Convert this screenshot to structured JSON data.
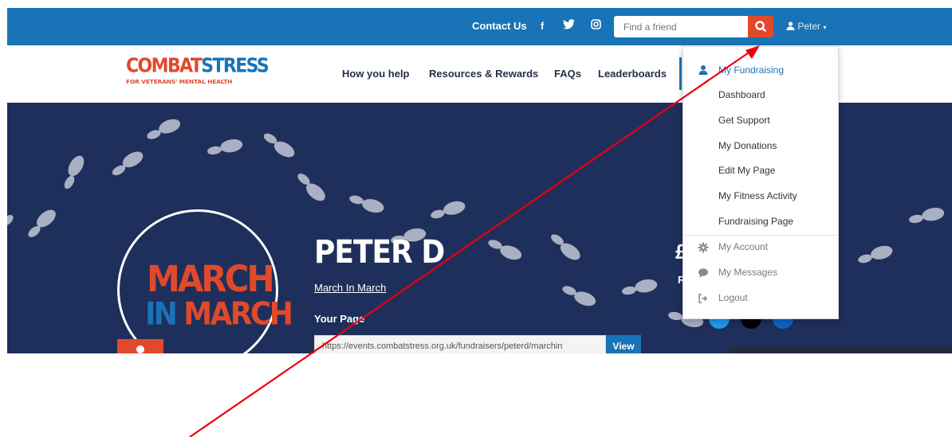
{
  "topbar": {
    "contact_label": "Contact Us",
    "social": [
      "facebook-icon",
      "twitter-icon",
      "instagram-icon"
    ],
    "search_placeholder": "Find a friend",
    "user_name": "Peter"
  },
  "brand": {
    "name": "COMBAT STRESS",
    "tagline": "FOR VETERANS' MENTAL HEALTH"
  },
  "nav": {
    "items": [
      "How you help",
      "Resources & Rewards",
      "FAQs",
      "Leaderboards"
    ]
  },
  "hero": {
    "badge_line1": "MARCH",
    "badge_in": "IN",
    "badge_line2": "MARCH",
    "fundraiser_name": "PETER D",
    "event_link": "March In March",
    "your_page_label": "Your Page",
    "page_url": "https://events.combatstress.org.uk/fundraisers/peterd/marchin",
    "view_button": "View",
    "partial_stat": "£",
    "partial_label": "R"
  },
  "dropdown": {
    "header": "My Fundraising",
    "items": [
      "Dashboard",
      "Get Support",
      "My Donations",
      "Edit My Page",
      "My Fitness Activity",
      "Fundraising Page"
    ],
    "account_items": [
      "My Account",
      "My Messages",
      "Logout"
    ]
  },
  "colors": {
    "brand_blue": "#1874b6",
    "brand_orange": "#e1492b",
    "hero_navy": "#1f2f5b",
    "annotation_red": "#e8000e"
  }
}
